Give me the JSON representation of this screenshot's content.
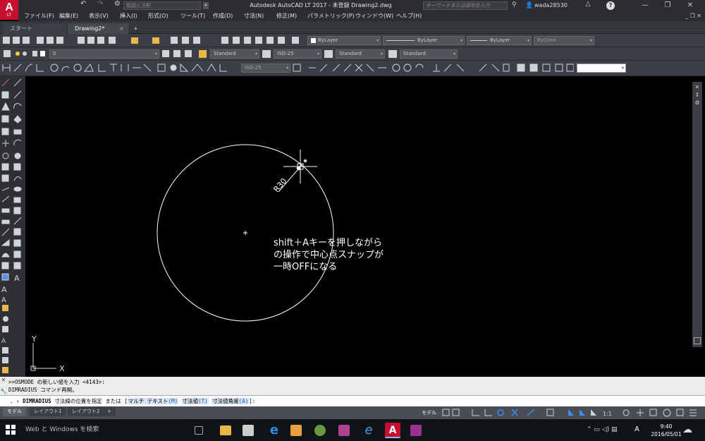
{
  "app": {
    "logo": "A",
    "logo_sub": "LT",
    "window_title": "Autodesk AutoCAD LT 2017 - 未登録    Drawing2.dwg",
    "workspace_placeholder": "製図と注釈",
    "search_placeholder": "キーワードまたは語句を入力",
    "user_name": "wada28530"
  },
  "menu": [
    {
      "label": "ファイル(F)"
    },
    {
      "label": "編集(E)"
    },
    {
      "label": "表示(V)"
    },
    {
      "label": "挿入(I)"
    },
    {
      "label": "形式(O)"
    },
    {
      "label": "ツール(T)"
    },
    {
      "label": "作成(D)"
    },
    {
      "label": "寸法(N)"
    },
    {
      "label": "修正(M)"
    },
    {
      "label": "パラメトリック(P)"
    },
    {
      "label": "ウィンドウ(W)"
    },
    {
      "label": "ヘルプ(H)"
    }
  ],
  "tabs": {
    "start": "スタート",
    "drawing": "Drawing2*",
    "close": "×",
    "new": "+"
  },
  "toolbar1": {
    "color_combo": "ByLayer",
    "linetype_combo": "ByLayer",
    "lineweight_combo": "ByLayer",
    "plotstyle_combo": "ByColor"
  },
  "toolbar2": {
    "layer_combo": "0",
    "text_style": "Standard",
    "dim_style": "ISO-25",
    "table_style": "Standard",
    "mleader_style": "Standard"
  },
  "toolbar3": {
    "dim_style": "ISO-25",
    "empty_combo": ""
  },
  "drawing": {
    "dimension_text": "R30",
    "ucs_x": "X",
    "ucs_y": "Y"
  },
  "note": {
    "line1": "shift＋Aキーを押しながら",
    "line2": "の操作で中心点スナップが",
    "line3": "一時OFFになる"
  },
  "command": {
    "history1": ">>OSMODE の新しい値を入力 <4143>:",
    "history2": "DIMRADIUS コマンド再開。",
    "prompt_cmd": "DIMRADIUS",
    "prompt_text": "寸法線の位置を指定 または [",
    "opt1": "マルチ テキスト",
    "opt1_key": "(M)",
    "opt2": "寸法値",
    "opt2_key": "(T)",
    "opt3": "寸法値角度",
    "opt3_key": "(A)",
    "prompt_end": "]:"
  },
  "layout_tabs": [
    "モデル",
    "レイアウト1",
    "レイアウト2",
    "+"
  ],
  "status": {
    "model": "モデル",
    "scale": "1:1"
  },
  "taskbar": {
    "search": "Web と Windows を検索",
    "time": "9:40",
    "date": "2016/05/01",
    "ime": "A"
  },
  "colors": {
    "acad_red": "#c8102e",
    "ui_dark": "#3b3e44",
    "status_blue": "#3e8ef7"
  }
}
